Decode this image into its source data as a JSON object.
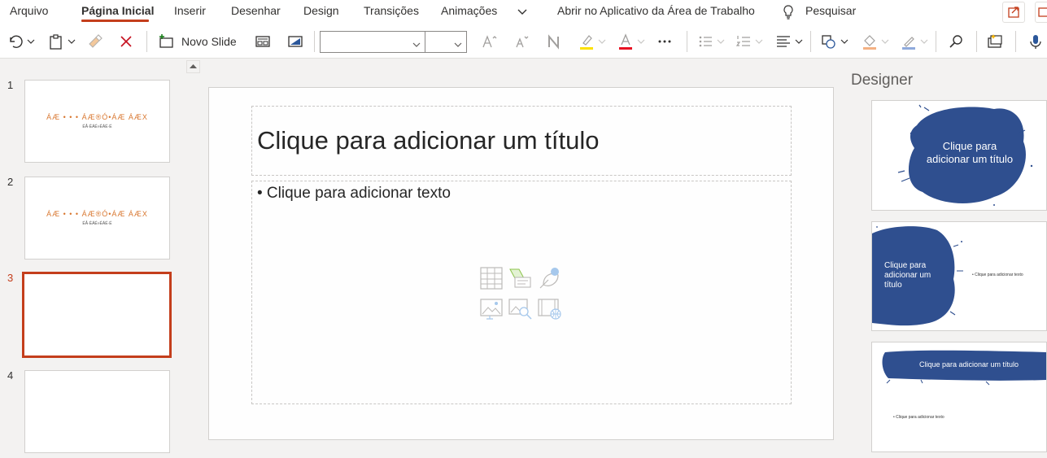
{
  "ribbon": {
    "tabs": [
      "Arquivo",
      "Página Inicial",
      "Inserir",
      "Desenhar",
      "Design",
      "Transições",
      "Animações"
    ],
    "active_tab": "Página Inicial",
    "open_desktop": "Abrir no Aplicativo da Área de Trabalho",
    "search_label": "Pesquisar",
    "accent": "#c43e1c"
  },
  "commands": {
    "new_slide_label": "Novo Slide",
    "font_name_value": "",
    "font_size_value": "",
    "icons": [
      "undo-icon",
      "paste-icon",
      "format-painter-icon",
      "delete-icon",
      "new-slide-icon",
      "layout-icon",
      "background-icon",
      "grow-font-icon",
      "shrink-font-icon",
      "clear-format-icon",
      "highlight-icon",
      "font-color-icon",
      "more-icon",
      "bullets-icon",
      "numbering-icon",
      "align-icon",
      "shapes-icon",
      "shape-fill-icon",
      "shape-outline-icon",
      "find-icon",
      "design-ideas-icon",
      "dictate-icon"
    ]
  },
  "thumbnails": [
    {
      "number": "1",
      "title": "ÁÆ • • • ÁÆ®Ó•ÁÆ ÁÆX",
      "subtitle": "ÉÂ·ÉÁÉ»ÉÁÉ·É"
    },
    {
      "number": "2",
      "title": "ÁÆ • • • ÁÆ®Ó•ÁÆ ÁÆX",
      "subtitle": "ÉÂ·ÉÁÉ»ÉÁÉ·É"
    },
    {
      "number": "3",
      "title": "",
      "subtitle": "",
      "selected": true
    },
    {
      "number": "4",
      "title": "",
      "subtitle": ""
    }
  ],
  "slide": {
    "title_placeholder": "Clique para adicionar um título",
    "body_placeholder": "• Clique para adicionar texto",
    "insert_icons": [
      "table-icon",
      "smartart-icon",
      "icons-icon",
      "picture-icon",
      "online-picture-icon",
      "video-icon"
    ]
  },
  "designer": {
    "title": "Designer",
    "ideas": [
      {
        "title": "Clique para adicionar um título"
      },
      {
        "title": "Clique para adicionar um título",
        "bullet": "• Clique para adicionar texto"
      },
      {
        "title": "Clique para adicionar um título",
        "bullet": "• Clique para adicionar texto"
      }
    ],
    "brand_color": "#2f4f8f"
  }
}
